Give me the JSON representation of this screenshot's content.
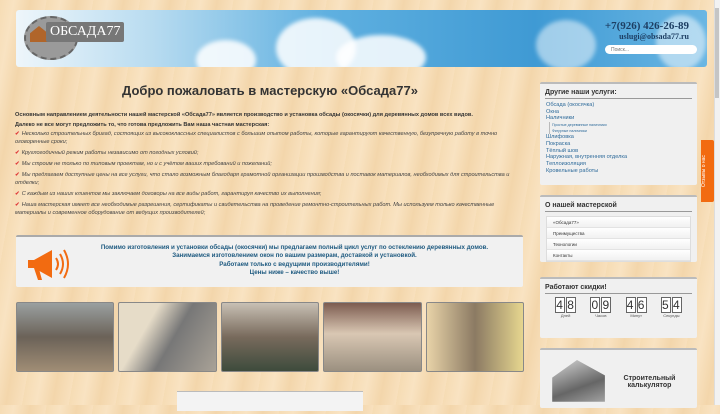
{
  "header": {
    "logo_text": "ОБСАДА77",
    "phone": "+7(926) 426-26-89",
    "email": "uslugi@obsada77.ru",
    "search_placeholder": "Поиск..."
  },
  "main": {
    "title": "Добро пожаловать в мастерскую «Обсада77»",
    "intro1": "Основным направлением деятельности нашей мастерской «Обсада77» является производство и установка обсады (окосячки) для деревянных домов всех видов.",
    "intro2": "Далеко не все могут предложить то, что готова предложить Вам наша частная мастерская:",
    "items": [
      "Несколько строительных бригад, состоящих из высококлассных специалистов с большим опытом работы, которые гарантируют качественную, безупречную работу в точно оговоренные сроки;",
      "Круглогодичный режим работы независимо от погодных условий;",
      "Мы строим не только по типовым проектам, но и с учётом ваших требований и пожеланий;",
      "Мы предлагаем доступные цены на все услуги, что стало возможным благодаря грамотной организации производства и поставок материалов, необходимых для строительства и отделки;",
      "С каждым из наших клиентов мы заключаем договоры на все виды работ, гарантируя качество их выполнения;",
      "Наша мастерская имеет все необходимые разрешения, сертификаты и свидетельства на проведение ремонтно-строительных работ. Мы используем только качественные материалы и современное оборудование от ведущих производителей;"
    ],
    "promo": [
      "Помимо изготовления и установки обсады (окосячки) мы предлагаем полный цикл услуг по остеклению деревянных домов.",
      "Занимаемся изготовлением окон по вашим размерам, доставкой и установкой.",
      "Работаем только с ведущими производителями!",
      "Цены ниже – качество выше!"
    ]
  },
  "sidebar": {
    "services_title": "Другие наши услуги:",
    "services": [
      "Обсада (окосячка)",
      "Окна",
      "Наличники",
      "Простые деревянные наличники",
      "Фигурные наличники",
      "Шлифовка",
      "Покраска",
      "Тёплый шов",
      "Наружная, внутренняя отделка",
      "Теплоизоляция",
      "Кровельные работы"
    ],
    "about_title": "О нашей мастерской",
    "about": [
      "«Обсада77»",
      "Преимущества",
      "Технологии",
      "Контакты"
    ],
    "discount_title": "Работают скидки!",
    "timer": [
      {
        "value": "48",
        "label": "Дней"
      },
      {
        "value": "09",
        "label": "Часов"
      },
      {
        "value": "46",
        "label": "Минут"
      },
      {
        "value": "54",
        "label": "Секунды"
      }
    ],
    "calculator": "Строительный калькулятор"
  },
  "feedback_tab": "Отзывы о нас",
  "colors": {
    "accent": "#f26b11",
    "link": "#2d6a9a",
    "promo_text": "#1e5a80"
  }
}
